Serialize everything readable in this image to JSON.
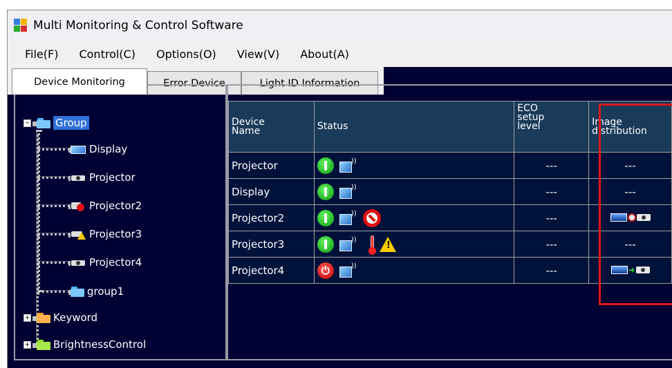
{
  "window": {
    "title": "Multi Monitoring & Control Software"
  },
  "menu": [
    "File(F)",
    "Control(C)",
    "Options(O)",
    "View(V)",
    "About(A)"
  ],
  "tabs": [
    "Device Monitoring",
    "Error Device",
    "Light ID Information"
  ],
  "tree": {
    "root": "Group",
    "children": [
      "Display",
      "Projector",
      "Projector2",
      "Projector3",
      "Projector4",
      "group1"
    ],
    "siblings": [
      "Keyword",
      "BrightnessControl"
    ]
  },
  "table": {
    "headers": {
      "device_name": "Device\nName",
      "status": "Status",
      "eco": "ECO\nsetup\nlevel",
      "image": "Image\ndistribution"
    },
    "rows": [
      {
        "name": "Projector",
        "eco": "---",
        "image": "---"
      },
      {
        "name": "Display",
        "eco": "---",
        "image": "---"
      },
      {
        "name": "Projector2",
        "eco": "---",
        "image": ""
      },
      {
        "name": "Projector3",
        "eco": "---",
        "image": "---"
      },
      {
        "name": "Projector4",
        "eco": "---",
        "image": ""
      }
    ]
  },
  "colors": {
    "background": "#000033",
    "header_bg": "#1a3a5a",
    "highlight": "#e01818",
    "selection": "#3070d8"
  }
}
